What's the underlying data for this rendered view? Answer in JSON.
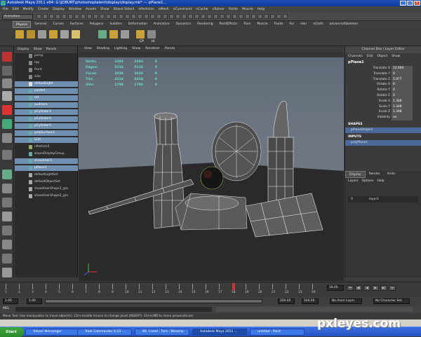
{
  "window": {
    "title": "Autodesk Maya 2011 x64: G:\\JOBURT\\photoshoptalent\\display\\display.mb* --- pPlane1..."
  },
  "menubar": {
    "items": [
      "File",
      "Edit",
      "Modify",
      "Create",
      "Display",
      "Window",
      "Assets",
      "Show",
      "Shave Select",
      "nParticles",
      "nMesh",
      "nConstraint",
      "nCache",
      "nSolver",
      "Fields",
      "Muscle",
      "Help"
    ]
  },
  "status": {
    "mode": "Animation"
  },
  "shelf_tabs": [
    "Physics",
    "General",
    "Curves",
    "Surfaces",
    "Polygons",
    "Subdivs",
    "Deformation",
    "Animation",
    "Dynamics",
    "Rendering",
    "PaintEffects",
    "Toon",
    "Muscle",
    "Fluids",
    "Fur",
    "Hair",
    "nCloth",
    "advancedSkeleton"
  ],
  "shelf_labels": {
    "cp": "CP",
    "hi": "Hi"
  },
  "outliner": {
    "menu": [
      "Display",
      "Show",
      "Panels"
    ],
    "items": [
      {
        "label": "persp",
        "selected": false,
        "color": "#888"
      },
      {
        "label": "top",
        "selected": false,
        "color": "#888"
      },
      {
        "label": "front",
        "selected": false,
        "color": "#888"
      },
      {
        "label": "side",
        "selected": false,
        "color": "#888"
      },
      {
        "label": "defaultLight",
        "selected": true,
        "color": "#ddd"
      },
      {
        "label": "pasted",
        "selected": true,
        "color": "#6aa"
      },
      {
        "label": "rut",
        "selected": true,
        "color": "#6aa"
      },
      {
        "label": "pudriera",
        "selected": true,
        "color": "#6aa"
      },
      {
        "label": "pCylinder3",
        "selected": true,
        "color": "#6aa"
      },
      {
        "label": "pCylinder4",
        "selected": true,
        "color": "#6aa"
      },
      {
        "label": "pCylinder5",
        "selected": true,
        "color": "#6aa"
      },
      {
        "label": "polySurface3",
        "selected": true,
        "color": "#6aa"
      },
      {
        "label": "G3A",
        "selected": true,
        "color": "#6aa"
      },
      {
        "label": "nParticle1",
        "selected": false,
        "color": "#9a6"
      },
      {
        "label": "shaveDisplayGroup",
        "selected": false,
        "color": "#6aa"
      },
      {
        "label": "shaveHair2",
        "selected": true,
        "color": "#6aa"
      },
      {
        "label": "pPlane1",
        "selected": true,
        "color": "#6aa"
      },
      {
        "label": "defaultLightSet",
        "selected": false,
        "color": "#aaa"
      },
      {
        "label": "defaultObjectSet",
        "selected": false,
        "color": "#aaa"
      },
      {
        "label": "shaveHairShape1_gro",
        "selected": false,
        "color": "#aaa"
      },
      {
        "label": "shaveHairShape2_gro",
        "selected": false,
        "color": "#aaa"
      }
    ]
  },
  "viewport": {
    "menu": [
      "View",
      "Shading",
      "Lighting",
      "Show",
      "Renderer",
      "Panels"
    ],
    "hud": [
      {
        "label": "Verts:",
        "a": "2393",
        "b": "2393",
        "c": "0"
      },
      {
        "label": "Edges:",
        "a": "5216",
        "b": "5216",
        "c": "0"
      },
      {
        "label": "Faces:",
        "a": "3036",
        "b": "3036",
        "c": "0"
      },
      {
        "label": "Tris:",
        "a": "4324",
        "b": "4324",
        "c": "0"
      },
      {
        "label": "UVs:",
        "a": "1789",
        "b": "1789",
        "c": "0"
      }
    ]
  },
  "channelbox": {
    "header": "Channel Box / Layer Editor",
    "menu": [
      "Channels",
      "Edit",
      "Object",
      "Show"
    ],
    "object": "pPlane1",
    "attrs": [
      {
        "name": "Translate X",
        "value": "12.694"
      },
      {
        "name": "Translate Y",
        "value": "0"
      },
      {
        "name": "Translate Z",
        "value": "5.977"
      },
      {
        "name": "Rotate X",
        "value": "0"
      },
      {
        "name": "Rotate Y",
        "value": "0"
      },
      {
        "name": "Rotate Z",
        "value": "0"
      },
      {
        "name": "Scale X",
        "value": "1.348"
      },
      {
        "name": "Scale Y",
        "value": "1.348"
      },
      {
        "name": "Scale Z",
        "value": "1.348"
      },
      {
        "name": "Visibility",
        "value": "on"
      }
    ],
    "shapes_label": "SHAPES",
    "shape": "pPlaneShape1",
    "inputs_label": "INPUTS",
    "input": "polyPlane1"
  },
  "layers": {
    "tabs": [
      "Display",
      "Render",
      "Anim"
    ],
    "menu": [
      "Layers",
      "Options",
      "Help"
    ],
    "row": {
      "v": "V",
      "name": "layer1"
    }
  },
  "timeline": {
    "ticks": [
      "1",
      "2",
      "3",
      "4",
      "5",
      "6",
      "7",
      "8",
      "9",
      "10",
      "11",
      "12",
      "13",
      "14",
      "15",
      "16",
      "17",
      "18",
      "19",
      "20",
      "21",
      "22",
      "23",
      "24"
    ],
    "current": "18.00"
  },
  "range": {
    "start": "1.00",
    "start2": "1.00",
    "end1": "500.00",
    "end2": "500.00",
    "anim_layer": "No Anim Layer",
    "char_set": "No Character Set"
  },
  "mel": {
    "label": "MEL"
  },
  "helpline": "Move Tool: Use manipulator to move object(s). Ctrl+middle mouse to change pivot (INSERT). Ctrl+LMB to move perpendicular.",
  "taskbar": {
    "start": "Start",
    "tasks": [
      "Yahoo! Messenger",
      "Total Commander 6.53 -...",
      "80. Creed - Torn - Winamp",
      "Autodesk Maya 2011 ...",
      "untitled - Paint"
    ],
    "active_index": 3
  },
  "watermark": "pxleyes.com"
}
